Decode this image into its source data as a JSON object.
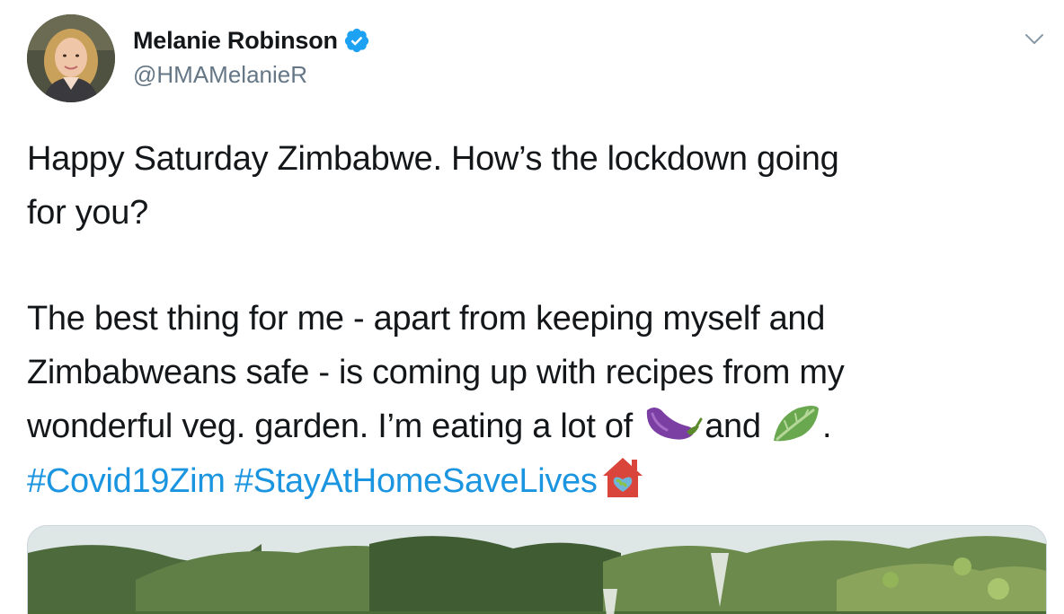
{
  "author": {
    "display_name": "Melanie Robinson",
    "handle": "@HMAMelanieR",
    "verified": true
  },
  "tweet": {
    "line1": "Happy Saturday Zimbabwe. How’s the lockdown going",
    "line2": "for you?",
    "line3": "The best thing for me - apart from keeping myself and",
    "line4": "Zimbabweans safe - is coming up with recipes from my",
    "line5_start": "wonderful veg. garden. I’m eating a lot of ",
    "line5_mid": "and ",
    "line5_end": ".",
    "hashtag1": "#Covid19Zim",
    "hashtag2": "#StayAtHomeSaveLives",
    "emoji_1": "eggplant-icon",
    "emoji_2": "leafy-green-icon",
    "emoji_3": "house-with-earth-heart-icon"
  },
  "colors": {
    "text": "#14171a",
    "handle": "#657786",
    "hashtag": "#1b95e0",
    "verified": "#1da1f2"
  },
  "icons": {
    "menu": "chevron-down-icon",
    "badge": "verified-badge-icon"
  }
}
